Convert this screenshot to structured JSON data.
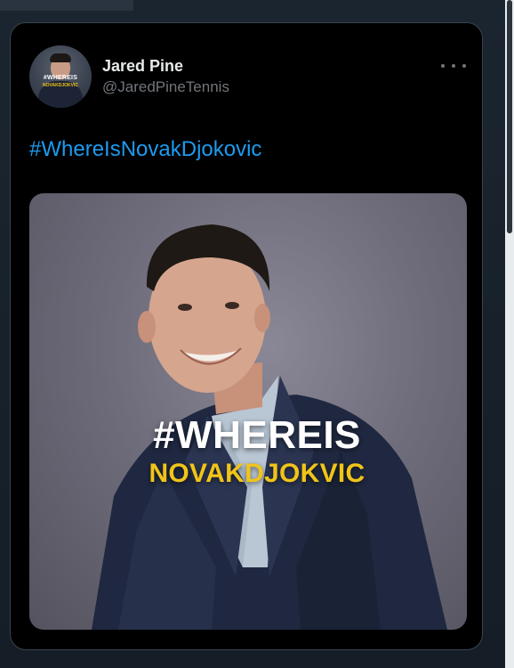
{
  "tweet": {
    "author_name": "Jared Pine",
    "author_handle": "@JaredPineTennis",
    "text": "#WhereIsNovakDjokovic",
    "more_icon": "more-horizontal-icon",
    "avatar": {
      "line1": "#WHEREIS",
      "line2": "NOVAKDJOKVIC"
    },
    "media": {
      "headline": "#WHEREIS",
      "subheadline": "NOVAKDJOKVIC"
    }
  },
  "colors": {
    "link": "#1d9bf0",
    "background": "#000000",
    "handle": "#71767b",
    "overlay_accent": "#f0c419"
  }
}
